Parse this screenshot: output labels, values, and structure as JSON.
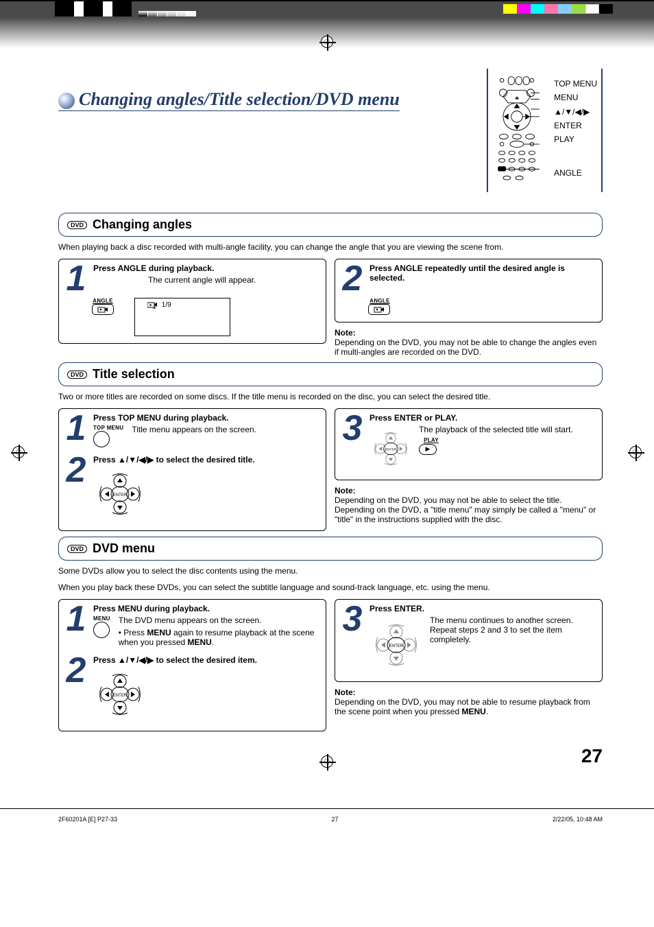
{
  "page_title": "Changing angles/Title selection/DVD menu",
  "remote_labels": {
    "top_menu": "TOP MENU",
    "menu": "MENU",
    "arrows": "▲/▼/◀/▶",
    "enter": "ENTER",
    "play": "PLAY",
    "angle": "ANGLE"
  },
  "dvd_chip": "DVD",
  "sections": {
    "changing_angles": {
      "heading": "Changing angles",
      "intro": "When playing back a disc recorded with multi-angle facility, you can change the angle that you are viewing the scene from.",
      "step1": {
        "title": "Press ANGLE during playback.",
        "desc": "The current angle will appear.",
        "btn_label": "ANGLE",
        "osd_text": "⎙↳ 1/9"
      },
      "step2": {
        "title": "Press ANGLE repeatedly until the desired angle is selected.",
        "btn_label": "ANGLE"
      },
      "note_head": "Note:",
      "note_body": "Depending on the DVD, you may not be able to change the angles even if multi-angles are recorded on the DVD."
    },
    "title_selection": {
      "heading": "Title selection",
      "intro": "Two or more titles are recorded on some discs. If the title menu is recorded on the disc, you can select the desired title.",
      "step1": {
        "title": "Press TOP MENU during playback.",
        "desc": "Title menu appears on the screen.",
        "btn_label": "TOP MENU"
      },
      "step2": {
        "title_pre": "Press ",
        "arrows": "▲/▼/◀/▶",
        "title_post": " to select the desired title."
      },
      "step3": {
        "title": "Press ENTER or PLAY.",
        "desc": "The playback of the selected title will start.",
        "play_label": "PLAY"
      },
      "note_head": "Note:",
      "note_body": "Depending on the DVD, you may not be able to select the title. Depending on the DVD, a \"title menu\" may simply be called a \"menu\" or \"title\" in the instructions supplied with the disc."
    },
    "dvd_menu": {
      "heading": "DVD menu",
      "intro_a": "Some DVDs allow you to select the disc contents using the menu.",
      "intro_b": "When you play back these DVDs, you can select the subtitle language and sound-track language, etc. using the menu.",
      "step1": {
        "title": "Press MENU during playback.",
        "desc_a": "The DVD menu appears on the screen.",
        "desc_b_pre": "• Press ",
        "desc_b_bold": "MENU",
        "desc_b_mid": " again to resume playback at the scene when you pressed ",
        "desc_b_bold2": "MENU",
        "desc_b_end": ".",
        "btn_label": "MENU"
      },
      "step2": {
        "title_pre": "Press ",
        "arrows": "▲/▼/◀/▶",
        "title_post": " to select the desired item."
      },
      "step3": {
        "title": "Press ENTER.",
        "desc": "The menu continues to another screen. Repeat steps 2 and 3 to set the item completely."
      },
      "note_head": "Note:",
      "note_body_pre": "Depending on the DVD, you may not be able to resume playback from the scene point when you pressed ",
      "note_body_bold": "MENU",
      "note_body_end": "."
    }
  },
  "page_number": "27",
  "footer": {
    "left": "2F60201A [E] P27-33",
    "mid": "27",
    "right": "2/22/05, 10:48 AM"
  }
}
